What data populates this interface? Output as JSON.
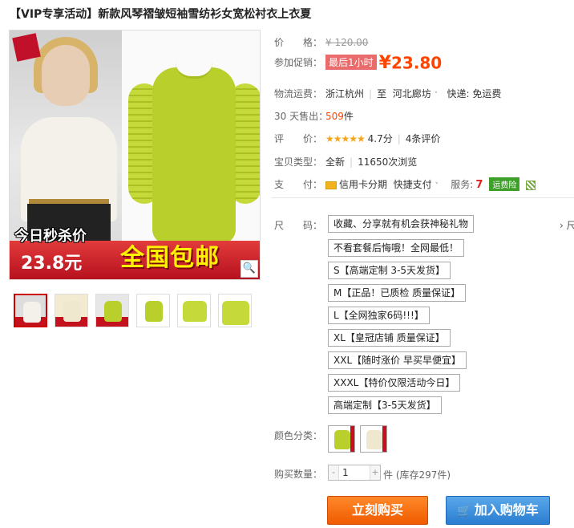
{
  "title": "【VIP专享活动】新款风琴褶皱短袖雪纺衫女宽松衬衣上衣夏",
  "image": {
    "promo_top": "今日秒杀价",
    "promo_price": "23.8元",
    "promo_free": "全国包邮",
    "zoom_icon": "magnifier-icon"
  },
  "price_row": {
    "label": "价　　格：",
    "original": "¥ 120.00"
  },
  "promo_row": {
    "label": "参加促销：",
    "flash": "最后1小时",
    "yen": "¥",
    "price": "23.80"
  },
  "shipping_row": {
    "label": "物流运费：",
    "origin": "浙江杭州",
    "to": "至",
    "dest": "河北廊坊",
    "caret": "˅",
    "express": "快递: 免运费"
  },
  "sales_row": {
    "label": "30 天售出：",
    "count": "509",
    "unit": "件"
  },
  "rating_row": {
    "label": "评　　价：",
    "stars": "★★★★★",
    "score": "4.7分",
    "reviews": "4条评价"
  },
  "type_row": {
    "label": "宝贝类型：",
    "condition": "全新",
    "views": "11650次浏览"
  },
  "pay_row": {
    "label": "支　　付：",
    "credit": "信用卡分期",
    "fast": "快捷支付",
    "caret": "˅",
    "service": "服务:",
    "seven": "7",
    "insurance": "运费险"
  },
  "size": {
    "label": "尺　　码：",
    "right_truncated": "› 尺",
    "options": [
      "收藏、分享就有机会获神秘礼物",
      "不看套餐后悔哦！全网最低！",
      "S【高端定制 3-5天发货】",
      "M【正品！已质检 质量保证】",
      "L【全网独家6码!!!】",
      "XL【皇冠店铺 质量保证】",
      "XXL【随时涨价 早买早便宜】",
      "XXXL【特价仅限活动今日】",
      "高端定制【3-5天发货】"
    ]
  },
  "color": {
    "label": "颜色分类："
  },
  "quantity": {
    "label": "购买数量：",
    "minus": "-",
    "value": "1",
    "plus": "+",
    "stock": "件 (库存297件)"
  },
  "buttons": {
    "buy": "立刻购买",
    "cart": "加入购物车"
  },
  "colors": {
    "accent": "#ff4400",
    "buy": "#f05a00",
    "cart": "#2a7ed1",
    "green": "#3e9f29"
  }
}
